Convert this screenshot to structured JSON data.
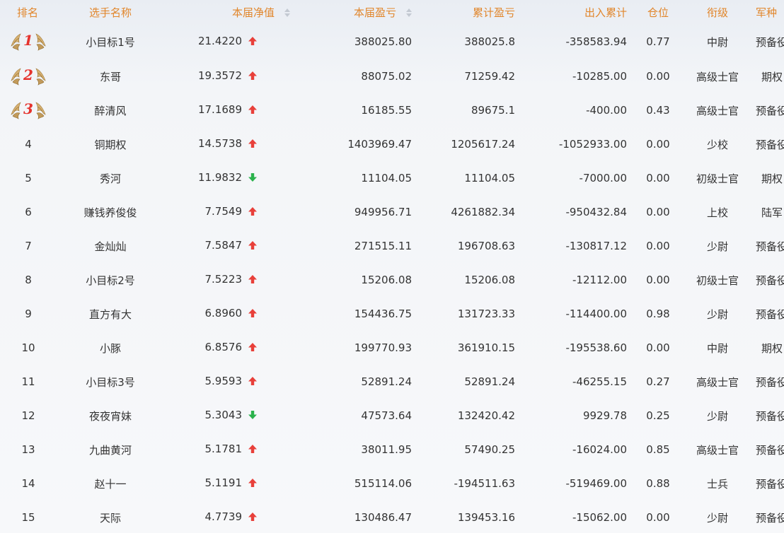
{
  "colors": {
    "header_text": "#e1862b",
    "up_arrow": "#e8403a",
    "down_arrow": "#2bb24c",
    "body_text": "#333333"
  },
  "headers": {
    "rank": "排名",
    "name": "选手名称",
    "nav": "本届净值",
    "pnl": "本届盈亏",
    "cum_pnl": "累计盈亏",
    "flow": "出入累计",
    "position": "仓位",
    "grade": "衔级",
    "branch": "军种"
  },
  "rows": [
    {
      "rank": "1",
      "medal": true,
      "name": "小目标1号",
      "nav": "21.4220",
      "trend": "up",
      "pnl": "388025.80",
      "cum_pnl": "388025.8",
      "flow": "-358583.94",
      "position": "0.77",
      "grade": "中尉",
      "branch": "预备役"
    },
    {
      "rank": "2",
      "medal": true,
      "name": "东哥",
      "nav": "19.3572",
      "trend": "up",
      "pnl": "88075.02",
      "cum_pnl": "71259.42",
      "flow": "-10285.00",
      "position": "0.00",
      "grade": "高级士官",
      "branch": "期权"
    },
    {
      "rank": "3",
      "medal": true,
      "name": "醉清风",
      "nav": "17.1689",
      "trend": "up",
      "pnl": "16185.55",
      "cum_pnl": "89675.1",
      "flow": "-400.00",
      "position": "0.43",
      "grade": "高级士官",
      "branch": "预备役"
    },
    {
      "rank": "4",
      "medal": false,
      "name": "铜期权",
      "nav": "14.5738",
      "trend": "up",
      "pnl": "1403969.47",
      "cum_pnl": "1205617.24",
      "flow": "-1052933.00",
      "position": "0.00",
      "grade": "少校",
      "branch": "预备役"
    },
    {
      "rank": "5",
      "medal": false,
      "name": "秀河",
      "nav": "11.9832",
      "trend": "down",
      "pnl": "11104.05",
      "cum_pnl": "11104.05",
      "flow": "-7000.00",
      "position": "0.00",
      "grade": "初级士官",
      "branch": "期权"
    },
    {
      "rank": "6",
      "medal": false,
      "name": "赚钱养俊俊",
      "nav": "7.7549",
      "trend": "up",
      "pnl": "949956.71",
      "cum_pnl": "4261882.34",
      "flow": "-950432.84",
      "position": "0.00",
      "grade": "上校",
      "branch": "陆军"
    },
    {
      "rank": "7",
      "medal": false,
      "name": "金灿灿",
      "nav": "7.5847",
      "trend": "up",
      "pnl": "271515.11",
      "cum_pnl": "196708.63",
      "flow": "-130817.12",
      "position": "0.00",
      "grade": "少尉",
      "branch": "预备役"
    },
    {
      "rank": "8",
      "medal": false,
      "name": "小目标2号",
      "nav": "7.5223",
      "trend": "up",
      "pnl": "15206.08",
      "cum_pnl": "15206.08",
      "flow": "-12112.00",
      "position": "0.00",
      "grade": "初级士官",
      "branch": "预备役"
    },
    {
      "rank": "9",
      "medal": false,
      "name": "直方有大",
      "nav": "6.8960",
      "trend": "up",
      "pnl": "154436.75",
      "cum_pnl": "131723.33",
      "flow": "-114400.00",
      "position": "0.98",
      "grade": "少尉",
      "branch": "预备役"
    },
    {
      "rank": "10",
      "medal": false,
      "name": "小豚",
      "nav": "6.8576",
      "trend": "up",
      "pnl": "199770.93",
      "cum_pnl": "361910.15",
      "flow": "-195538.60",
      "position": "0.00",
      "grade": "中尉",
      "branch": "期权"
    },
    {
      "rank": "11",
      "medal": false,
      "name": "小目标3号",
      "nav": "5.9593",
      "trend": "up",
      "pnl": "52891.24",
      "cum_pnl": "52891.24",
      "flow": "-46255.15",
      "position": "0.27",
      "grade": "高级士官",
      "branch": "预备役"
    },
    {
      "rank": "12",
      "medal": false,
      "name": "夜夜宵妹",
      "nav": "5.3043",
      "trend": "down",
      "pnl": "47573.64",
      "cum_pnl": "132420.42",
      "flow": "9929.78",
      "position": "0.25",
      "grade": "少尉",
      "branch": "预备役"
    },
    {
      "rank": "13",
      "medal": false,
      "name": "九曲黄河",
      "nav": "5.1781",
      "trend": "up",
      "pnl": "38011.95",
      "cum_pnl": "57490.25",
      "flow": "-16024.00",
      "position": "0.85",
      "grade": "高级士官",
      "branch": "预备役"
    },
    {
      "rank": "14",
      "medal": false,
      "name": "赵十一",
      "nav": "5.1191",
      "trend": "up",
      "pnl": "515114.06",
      "cum_pnl": "-194511.63",
      "flow": "-519469.00",
      "position": "0.88",
      "grade": "士兵",
      "branch": "预备役"
    },
    {
      "rank": "15",
      "medal": false,
      "name": "天际",
      "nav": "4.7739",
      "trend": "up",
      "pnl": "130486.47",
      "cum_pnl": "139453.16",
      "flow": "-15062.00",
      "position": "0.00",
      "grade": "少尉",
      "branch": "预备役"
    }
  ]
}
